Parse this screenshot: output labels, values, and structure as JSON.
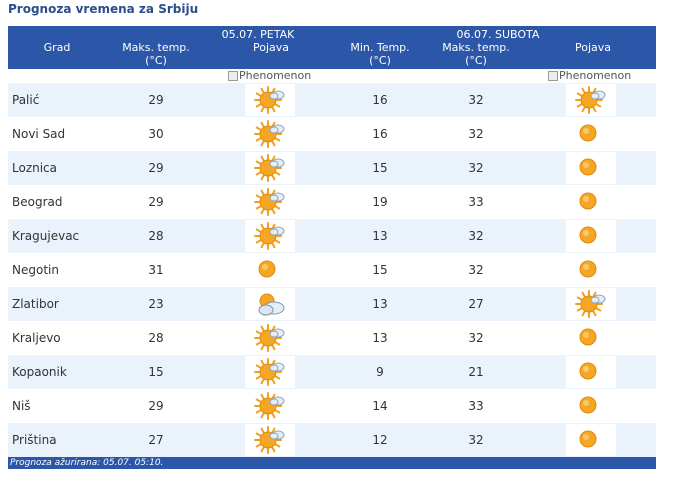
{
  "page_title": "Prognoza vremena za Srbiju",
  "header": {
    "day1": "05.07. PETAK",
    "day2": "06.07. SUBOTA",
    "city_col": "Grad",
    "max_temp": "Maks. temp.",
    "min_temp": "Min. Temp.",
    "unit": "(°C)",
    "phenomenon": "Pojava"
  },
  "broken_image_alt": "Phenomenon",
  "rows": [
    {
      "city": "Palić",
      "d1_max": "29",
      "d1_icon": "sun-cloud-icon",
      "d2_min": "16",
      "d2_max": "32",
      "d2_icon": "sun-cloud-icon"
    },
    {
      "city": "Novi Sad",
      "d1_max": "30",
      "d1_icon": "sun-cloud-icon",
      "d2_min": "16",
      "d2_max": "32",
      "d2_icon": "sun-icon"
    },
    {
      "city": "Loznica",
      "d1_max": "29",
      "d1_icon": "sun-cloud-icon",
      "d2_min": "15",
      "d2_max": "32",
      "d2_icon": "sun-icon"
    },
    {
      "city": "Beograd",
      "d1_max": "29",
      "d1_icon": "sun-cloud-icon",
      "d2_min": "19",
      "d2_max": "33",
      "d2_icon": "sun-icon"
    },
    {
      "city": "Kragujevac",
      "d1_max": "28",
      "d1_icon": "sun-cloud-icon",
      "d2_min": "13",
      "d2_max": "32",
      "d2_icon": "sun-icon"
    },
    {
      "city": "Negotin",
      "d1_max": "31",
      "d1_icon": "sun-icon",
      "d2_min": "15",
      "d2_max": "32",
      "d2_icon": "sun-icon"
    },
    {
      "city": "Zlatibor",
      "d1_max": "23",
      "d1_icon": "cloud-sun-icon",
      "d2_min": "13",
      "d2_max": "27",
      "d2_icon": "sun-cloud-icon"
    },
    {
      "city": "Kraljevo",
      "d1_max": "28",
      "d1_icon": "sun-cloud-icon",
      "d2_min": "13",
      "d2_max": "32",
      "d2_icon": "sun-icon"
    },
    {
      "city": "Kopaonik",
      "d1_max": "15",
      "d1_icon": "sun-cloud-icon",
      "d2_min": "9",
      "d2_max": "21",
      "d2_icon": "sun-icon"
    },
    {
      "city": "Niš",
      "d1_max": "29",
      "d1_icon": "sun-cloud-icon",
      "d2_min": "14",
      "d2_max": "33",
      "d2_icon": "sun-icon"
    },
    {
      "city": "Priština",
      "d1_max": "27",
      "d1_icon": "sun-cloud-icon",
      "d2_min": "12",
      "d2_max": "32",
      "d2_icon": "sun-icon"
    }
  ],
  "footer": "Prognoza ažurirana:  05.07. 05:10.",
  "colors": {
    "header_bg": "#2C56A8",
    "row_shade": "#EAF2FB",
    "title": "#2B4E8B",
    "sun": "#F5A623"
  }
}
